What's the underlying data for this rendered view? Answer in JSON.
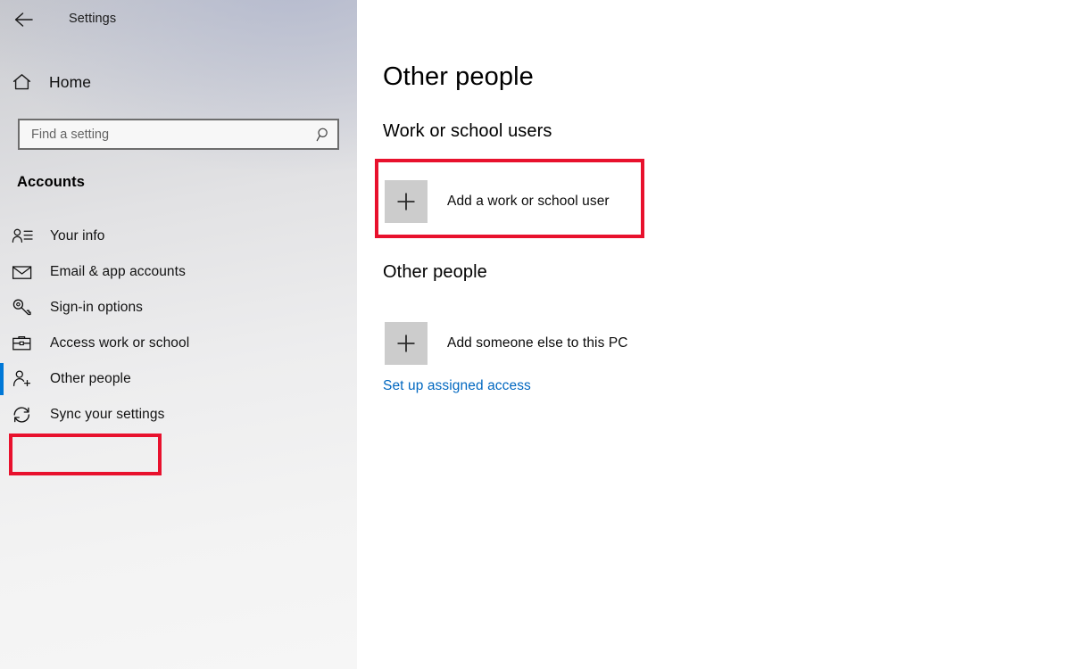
{
  "window": {
    "title": "Settings",
    "back_icon": "back-arrow-icon"
  },
  "sidebar": {
    "home": {
      "label": "Home",
      "icon": "home-icon"
    },
    "search": {
      "placeholder": "Find a setting",
      "value": "",
      "icon": "search-icon"
    },
    "heading": "Accounts",
    "items": [
      {
        "label": "Your info",
        "icon": "user-info-icon",
        "selected": false
      },
      {
        "label": "Email & app accounts",
        "icon": "envelope-icon",
        "selected": false
      },
      {
        "label": "Sign-in options",
        "icon": "key-icon",
        "selected": false
      },
      {
        "label": "Access work or school",
        "icon": "briefcase-icon",
        "selected": false
      },
      {
        "label": "Other people",
        "icon": "add-user-icon",
        "selected": true
      },
      {
        "label": "Sync your settings",
        "icon": "sync-icon",
        "selected": false
      }
    ]
  },
  "main": {
    "page_title": "Other people",
    "groups": [
      {
        "title": "Work or school users",
        "action": {
          "label": "Add a work or school user",
          "icon": "plus-icon"
        }
      },
      {
        "title": "Other people",
        "action": {
          "label": "Add someone else to this PC",
          "icon": "plus-icon"
        }
      }
    ],
    "link": {
      "label": "Set up assigned access"
    }
  },
  "annotations": {
    "color": "#e8112d",
    "boxes": [
      {
        "name": "sidebar-other-people-highlight"
      },
      {
        "name": "add-work-or-school-user-highlight"
      }
    ]
  },
  "colors": {
    "accent": "#0078d7",
    "link": "#0067c0",
    "plus_box": "#cccccc",
    "annotation_red": "#e8112d"
  }
}
